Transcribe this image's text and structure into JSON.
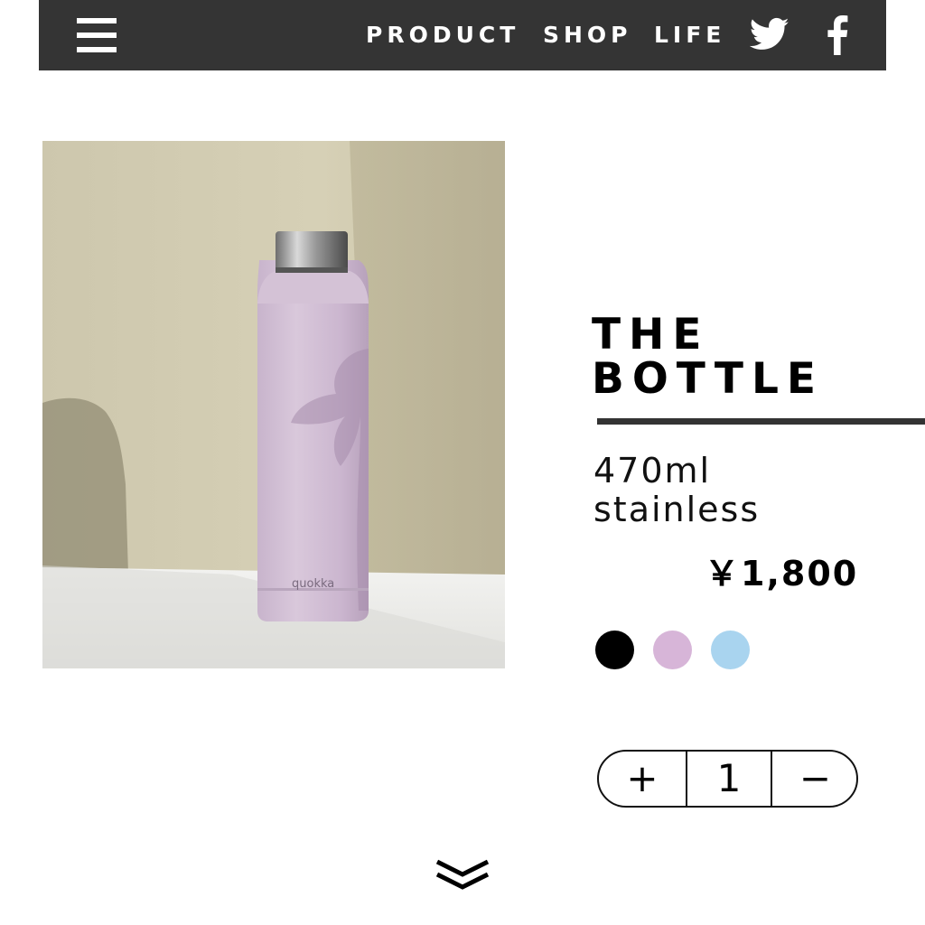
{
  "header": {
    "nav": [
      {
        "label": "PRODUCT"
      },
      {
        "label": "SHOP"
      },
      {
        "label": "LIFE"
      }
    ],
    "icons": [
      "hamburger-menu-icon",
      "twitter-icon",
      "facebook-icon"
    ],
    "background_color": "#343434"
  },
  "photo": {
    "bottle_brand": "quokka"
  },
  "product": {
    "title_line1": "THE",
    "title_line2": "BOTTLE",
    "desc_line1": "470ml",
    "desc_line2": "stainless",
    "price": "￥1,800",
    "colors": [
      "#000000",
      "#d7b5d8",
      "#a9d4ef"
    ]
  },
  "quantity": {
    "plus": "+",
    "value": "1",
    "minus": "−"
  }
}
